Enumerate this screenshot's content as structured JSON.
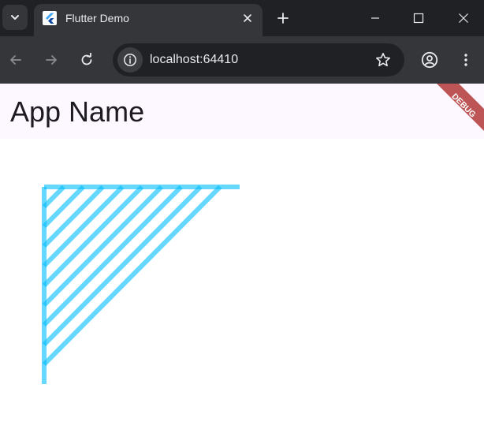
{
  "browser": {
    "tab": {
      "title": "Flutter Demo",
      "favicon": "flutter-logo-icon"
    },
    "address": {
      "url": "localhost:64410"
    },
    "icons": {
      "tab_search": "chevron-down-icon",
      "tab_close": "close-icon",
      "new_tab": "plus-icon",
      "minimize": "minimize-icon",
      "maximize": "maximize-icon",
      "close_window": "close-icon",
      "back": "arrow-left-icon",
      "forward": "arrow-right-icon",
      "reload": "reload-icon",
      "site_info": "info-icon",
      "bookmark": "star-icon",
      "profile": "account-icon",
      "menu": "more-vert-icon"
    }
  },
  "app": {
    "title": "App Name",
    "debug_banner": "DEBUG",
    "colors": {
      "appbar_bg": "#fdf7ff",
      "banner": "#b13737",
      "curve": "#00bcff"
    }
  }
}
